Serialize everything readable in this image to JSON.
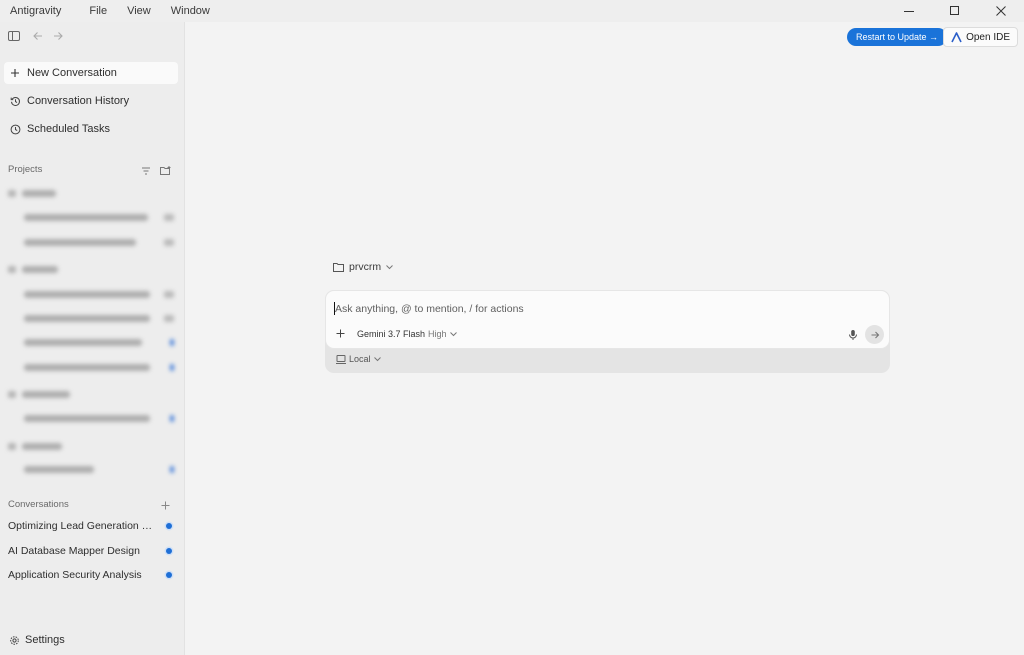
{
  "window": {
    "app_name": "Antigravity",
    "menu": [
      "File",
      "View",
      "Window"
    ]
  },
  "sidebar": {
    "nav": [
      {
        "label": "New Conversation",
        "icon": "plus-icon"
      },
      {
        "label": "Conversation History",
        "icon": "history-icon"
      },
      {
        "label": "Scheduled Tasks",
        "icon": "clock-icon"
      }
    ],
    "projects_label": "Projects",
    "conversations_label": "Conversations",
    "conversations": [
      {
        "title": "Optimizing Lead Generation St..."
      },
      {
        "title": "AI Database Mapper Design"
      },
      {
        "title": "Application Security Analysis"
      }
    ],
    "settings_label": "Settings"
  },
  "header": {
    "update_label": "Restart to Update →",
    "open_ide_label": "Open IDE"
  },
  "composer": {
    "project_name": "prvcrm",
    "placeholder": "Ask anything, @ to mention, / for actions",
    "model_name": "Gemini 3.7 Flash",
    "model_level": "High",
    "location": "Local"
  },
  "colors": {
    "accent": "#1a73d9",
    "sidebar_bg": "#ededed",
    "main_bg": "#f3f3f3"
  }
}
